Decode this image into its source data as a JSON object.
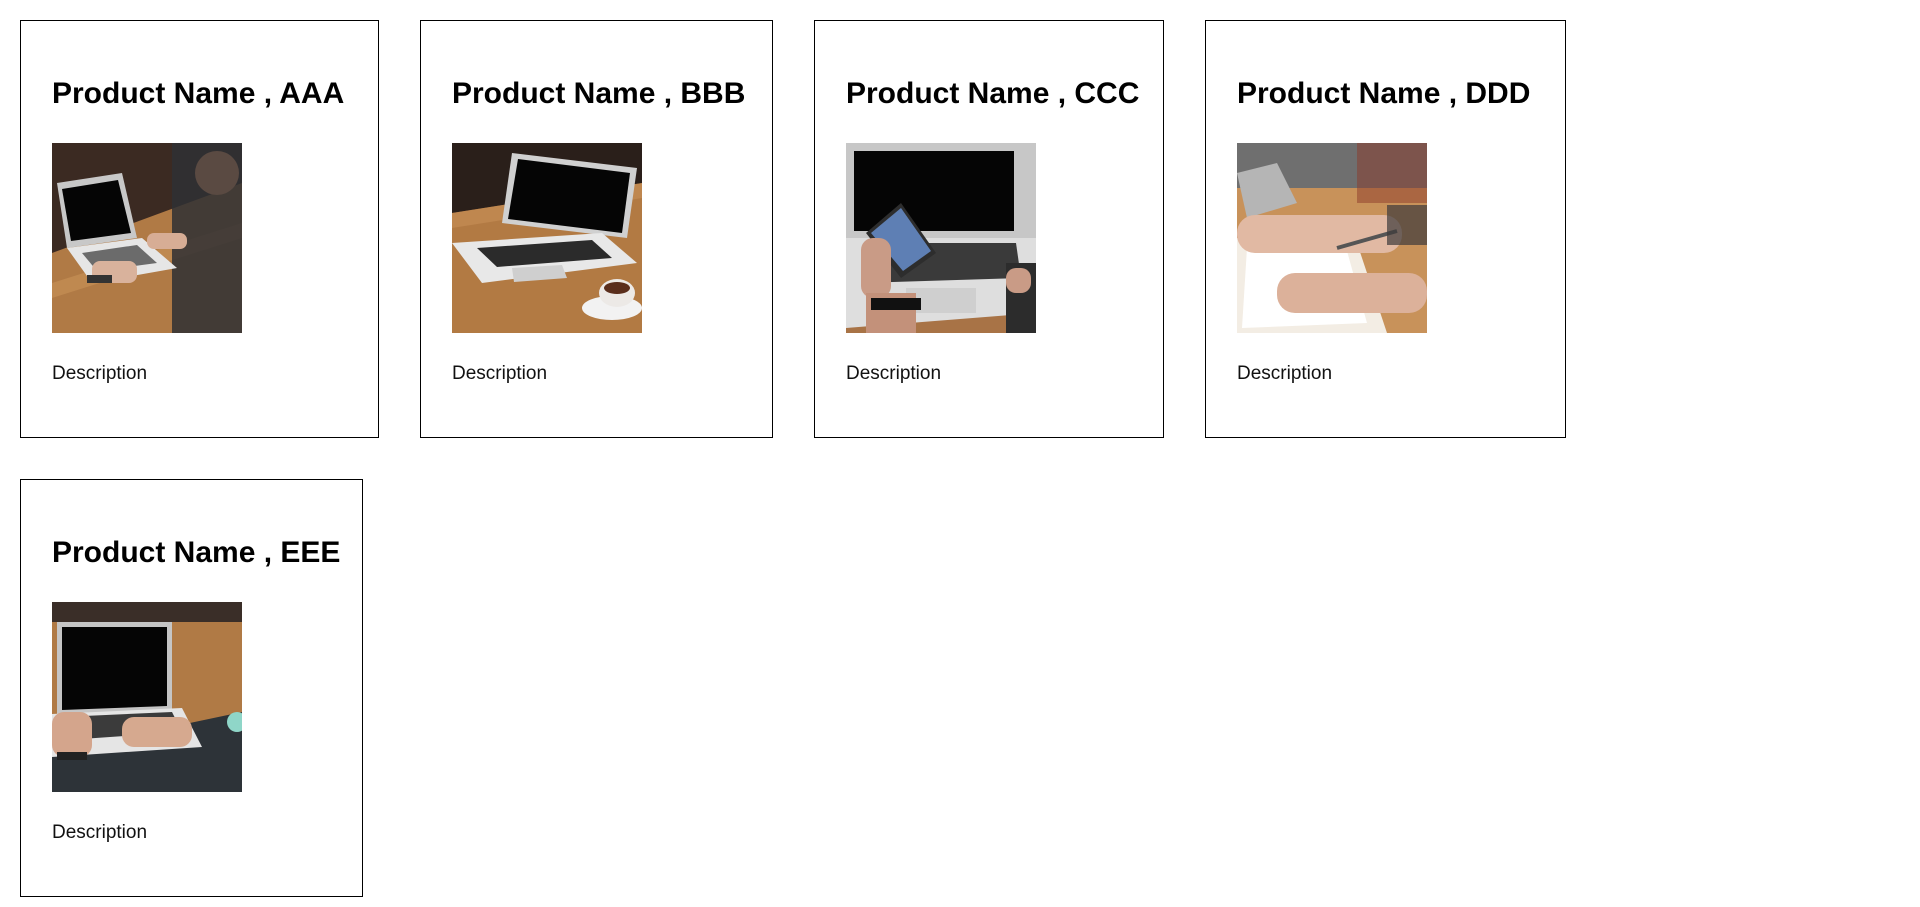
{
  "products": [
    {
      "title": "Product Name , AAA",
      "description": "Description",
      "image": "laptop-table-photo"
    },
    {
      "title": "Product Name , BBB",
      "description": "Description",
      "image": "laptop-coffee-photo"
    },
    {
      "title": "Product Name , CCC",
      "description": "Description",
      "image": "laptop-phone-photo"
    },
    {
      "title": "Product Name , DDD",
      "description": "Description",
      "image": "hands-notebook-photo"
    },
    {
      "title": "Product Name , EEE",
      "description": "Description",
      "image": "laptop-typing-photo"
    }
  ]
}
